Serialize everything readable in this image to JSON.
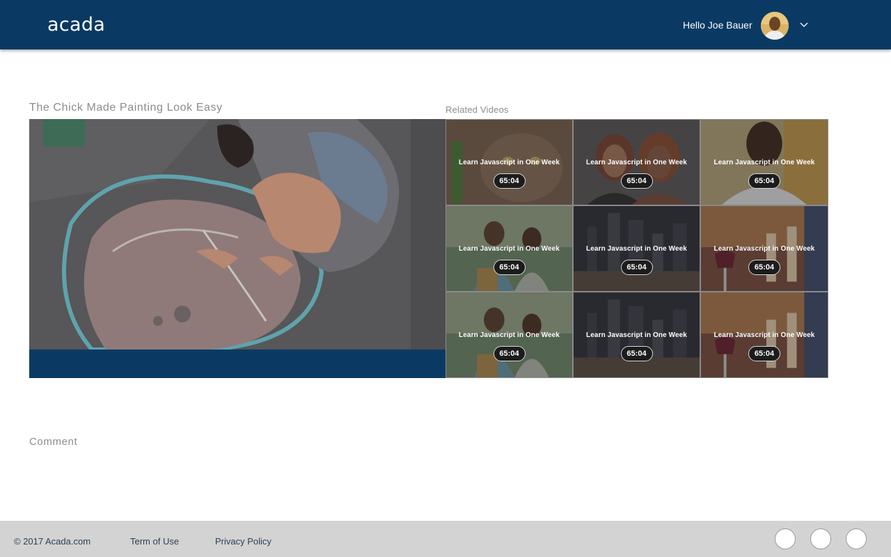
{
  "header": {
    "logo": "acada",
    "greeting": "Hello Joe Bauer"
  },
  "video": {
    "title": "The Chick Made Painting Look Easy"
  },
  "related": {
    "label": "Related Videos",
    "items": [
      {
        "title": "Learn Javascript in One Week",
        "duration": "65:04",
        "thumb": "cat"
      },
      {
        "title": "Learn Javascript in One Week",
        "duration": "65:04",
        "thumb": "two-women"
      },
      {
        "title": "Learn Javascript in One Week",
        "duration": "65:04",
        "thumb": "man-selfie"
      },
      {
        "title": "Learn Javascript in One Week",
        "duration": "65:04",
        "thumb": "couple-groceries"
      },
      {
        "title": "Learn Javascript in One Week",
        "duration": "65:04",
        "thumb": "city-night"
      },
      {
        "title": "Learn Javascript in One Week",
        "duration": "65:04",
        "thumb": "candles-wine"
      },
      {
        "title": "Learn Javascript in One Week",
        "duration": "65:04",
        "thumb": "couple-groceries"
      },
      {
        "title": "Learn Javascript in One Week",
        "duration": "65:04",
        "thumb": "city-night"
      },
      {
        "title": "Learn Javascript in One Week",
        "duration": "65:04",
        "thumb": "candles-wine"
      }
    ]
  },
  "comment": {
    "label": "Comment"
  },
  "footer": {
    "copyright": "© 2017 Acada.com",
    "terms": "Term of Use",
    "privacy": "Privacy Policy",
    "social": [
      "social-icon-1",
      "social-icon-2",
      "social-icon-3"
    ]
  },
  "colors": {
    "brand": "#0a3a63",
    "footer_bg": "#d3d3d3",
    "muted_text": "#8c8c8c"
  }
}
